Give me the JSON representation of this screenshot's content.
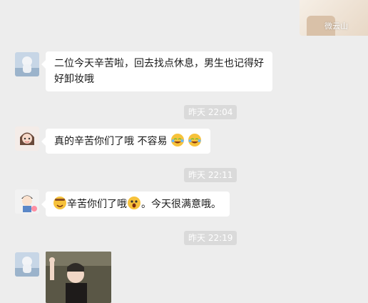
{
  "top_image": {
    "watermark": "微云山"
  },
  "messages": [
    {
      "text_line1": "二位今天辛苦啦，回去找点休息，男生也记得好",
      "text_line2": "好卸妆哦"
    },
    {
      "time": "昨天 22:04",
      "text": "真的辛苦你们了哦 不容易"
    },
    {
      "time": "昨天 22:11",
      "text_part1": "辛苦你们了哦",
      "text_part2": "。今天很满意哦。"
    },
    {
      "time": "昨天 22:19"
    }
  ],
  "icons": {
    "emoji_laugh": "laughing-crying-face-icon",
    "emoji_shock": "screaming-face-icon",
    "emoji_smile": "grinning-face-icon"
  },
  "colors": {
    "background": "#ededed",
    "bubble": "#ffffff",
    "time_badge": "#dadada"
  }
}
